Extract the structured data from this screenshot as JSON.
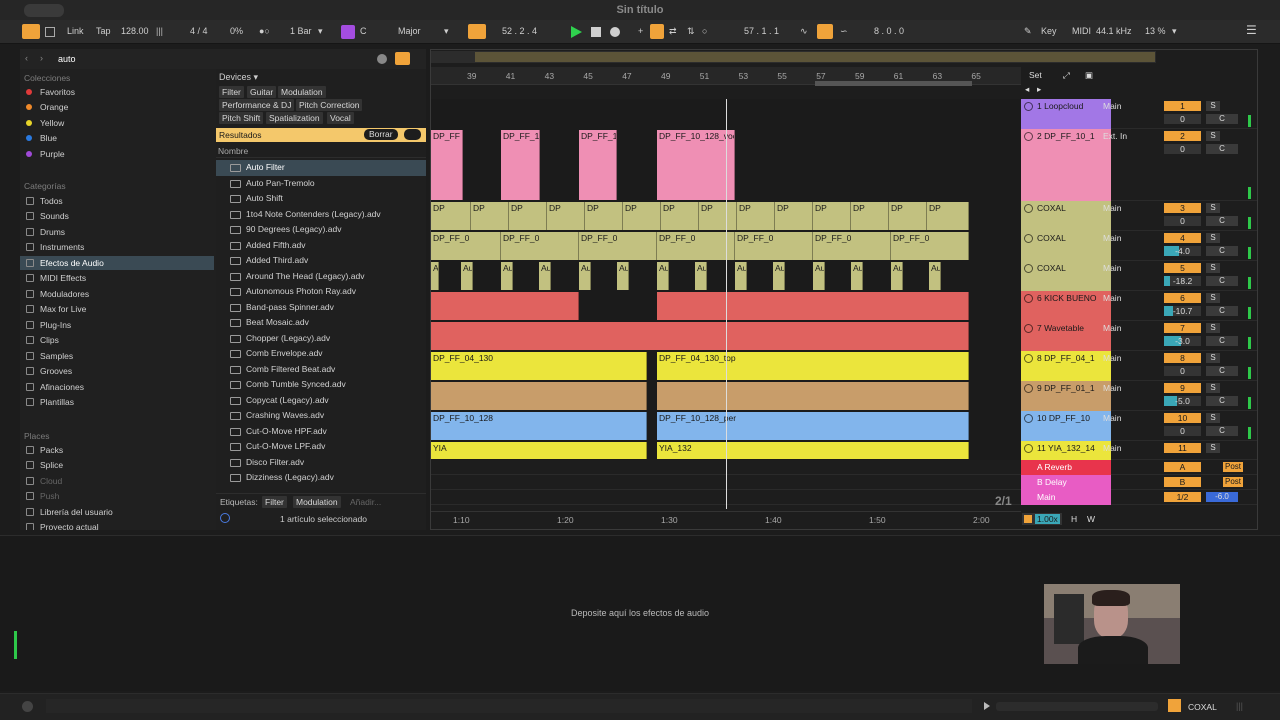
{
  "window": {
    "title": "Sin título"
  },
  "transport": {
    "link": "Link",
    "tap": "Tap",
    "tempo": "128.00",
    "signature": "4 / 4",
    "groove": "0%",
    "quantize": "1 Bar",
    "key": "C",
    "scale": "Major",
    "arrangement_position": "52 .  2 .  4",
    "loop_start": "57 .  1 .  1",
    "loop_length": "8 .  0 .  0",
    "key_label": "Key",
    "midi_label": "MIDI",
    "sample_rate": "44.1 kHz",
    "cpu": "13 %"
  },
  "browser": {
    "search_value": "auto",
    "collections_label": "Colecciones",
    "collections": [
      {
        "label": "Favoritos",
        "color": "#e03a3a"
      },
      {
        "label": "Orange",
        "color": "#f08a2a"
      },
      {
        "label": "Yellow",
        "color": "#e8d52a"
      },
      {
        "label": "Blue",
        "color": "#2a7ae0"
      },
      {
        "label": "Purple",
        "color": "#a04ad8"
      }
    ],
    "categories_label": "Categorías",
    "categories": [
      "Todos",
      "Sounds",
      "Drums",
      "Instruments",
      "Efectos de Audio",
      "MIDI Effects",
      "Moduladores",
      "Max for Live",
      "Plug-Ins",
      "Clips",
      "Samples",
      "Grooves",
      "Afinaciones",
      "Plantillas"
    ],
    "selected_category": "Efectos de Audio",
    "places_label": "Places",
    "places": [
      "Packs",
      "Splice",
      "Cloud",
      "Push",
      "Librería del usuario",
      "Proyecto actual"
    ],
    "devices_label": "Devices ▾",
    "filter_tags": [
      "Filter",
      "Guitar",
      "Modulation",
      "Performance & DJ",
      "Pitch Correction",
      "Pitch Shift",
      "Spatialization",
      "Vocal"
    ],
    "results_label": "Resultados",
    "clear_label": "Borrar",
    "name_header": "Nombre",
    "results": [
      "Auto Filter",
      "Auto Pan-Tremolo",
      "Auto Shift",
      "1to4 Note Contenders (Legacy).adv",
      "90 Degrees (Legacy).adv",
      "Added Fifth.adv",
      "Added Third.adv",
      "Around The Head (Legacy).adv",
      "Autonomous Photon Ray.adv",
      "Band-pass Spinner.adv",
      "Beat Mosaic.adv",
      "Chopper (Legacy).adv",
      "Comb Envelope.adv",
      "Comb Filtered Beat.adv",
      "Comb Tumble Synced.adv",
      "Copycat (Legacy).adv",
      "Crashing Waves.adv",
      "Cut-O-Move HPF.adv",
      "Cut-O-Move LPF.adv",
      "Disco Filter.adv",
      "Dizziness (Legacy).adv"
    ],
    "selected_result": "Auto Filter",
    "tags_label": "Etiquetas:",
    "tag_chips": [
      "Filter",
      "Modulation",
      "Añadir..."
    ],
    "selection_status": "1 artículo seleccionado"
  },
  "arrangement": {
    "ruler_marks": [
      "39",
      "41",
      "43",
      "45",
      "47",
      "49",
      "51",
      "53",
      "55",
      "57",
      "59",
      "61",
      "63",
      "65"
    ],
    "time_marks": [
      "1:10",
      "1:20",
      "1:30",
      "1:40",
      "1:50",
      "2:00"
    ],
    "set_label": "Set",
    "page_indicator": "2/1",
    "zoom": "1.00x",
    "tracks": [
      {
        "name": "1 Loopcloud",
        "color": "#a277e6",
        "input": "Main",
        "number": "1",
        "vol": "0",
        "vol_level": 0.0,
        "send": "C",
        "clips": []
      },
      {
        "name": "2 DP_FF_10_1",
        "color": "#ef8fb4",
        "input": "Ext. In",
        "number": "2",
        "vol": "0",
        "vol_level": 0.0,
        "send": "C",
        "clips": [
          "DP_FF",
          "DP_FF_1",
          "DP_FF_1",
          "DP_FF_10_128_voc"
        ]
      },
      {
        "name": "COXAL",
        "color": "#c2c180",
        "input": "Main",
        "number": "3",
        "vol": "0",
        "vol_level": 0.0,
        "send": "C",
        "clips": [
          "DP",
          "DP",
          "DP",
          "DP",
          "DP"
        ]
      },
      {
        "name": "COXAL",
        "color": "#c2c180",
        "input": "Main",
        "number": "4",
        "vol": "-4.0",
        "vol_level": 0.4,
        "send": "C",
        "clips": [
          "DP_FF_0",
          "DP_FF_0",
          "DP_FF_0",
          "DP_FF_0"
        ]
      },
      {
        "name": "COXAL",
        "color": "#c2c180",
        "input": "Main",
        "number": "5",
        "vol": "-18.2",
        "vol_level": 0.15,
        "send": "C",
        "clips": [
          "Au",
          "Au",
          "Au",
          "Au"
        ]
      },
      {
        "name": "6 KICK BUENO",
        "color": "#e0625f",
        "input": "Main",
        "number": "6",
        "vol": "-10.7",
        "vol_level": 0.25,
        "send": "C",
        "clips": []
      },
      {
        "name": "7 Wavetable",
        "color": "#e0625f",
        "input": "Main",
        "number": "7",
        "vol": "-3.0",
        "vol_level": 0.45,
        "send": "C",
        "clips": []
      },
      {
        "name": "8 DP_FF_04_1",
        "color": "#ebe53c",
        "input": "Main",
        "number": "8",
        "vol": "0",
        "vol_level": 0.0,
        "send": "C",
        "clips": [
          "DP_FF_04_130",
          "DP_FF_04_130_top",
          "DP_FF_04_130"
        ]
      },
      {
        "name": "9 DP_FF_01_1",
        "color": "#c89d6a",
        "input": "Main",
        "number": "9",
        "vol": "-5.0",
        "vol_level": 0.35,
        "send": "C",
        "clips": []
      },
      {
        "name": "10 DP_FF_10",
        "color": "#82b5ec",
        "input": "Main",
        "number": "10",
        "vol": "0",
        "vol_level": 0.0,
        "send": "C",
        "clips": [
          "DP_FF_10_128",
          "DP_FF_10_128_per",
          "DP_FF_10_128"
        ]
      },
      {
        "name": "11 YIA_132_14",
        "color": "#ebe53c",
        "input": "Main",
        "number": "11",
        "vol": "",
        "vol_level": 0.0,
        "send": "",
        "clips": [
          "YIA",
          "YIA_132",
          "YIA_132",
          "YIA_13"
        ]
      }
    ],
    "returns": [
      {
        "name": "A Reverb",
        "color": "#e8344c",
        "letter": "A",
        "post": "Post"
      },
      {
        "name": "B Delay",
        "color": "#e85cc4",
        "letter": "B",
        "post": "Post"
      },
      {
        "name": "Main",
        "color": "#e85cc4",
        "letter": "1/2",
        "vol": "-6.0"
      }
    ]
  },
  "device_area": {
    "drop_hint": "Deposite aquí los efectos de audio"
  },
  "status_bar": {
    "track_label": "COXAL"
  }
}
